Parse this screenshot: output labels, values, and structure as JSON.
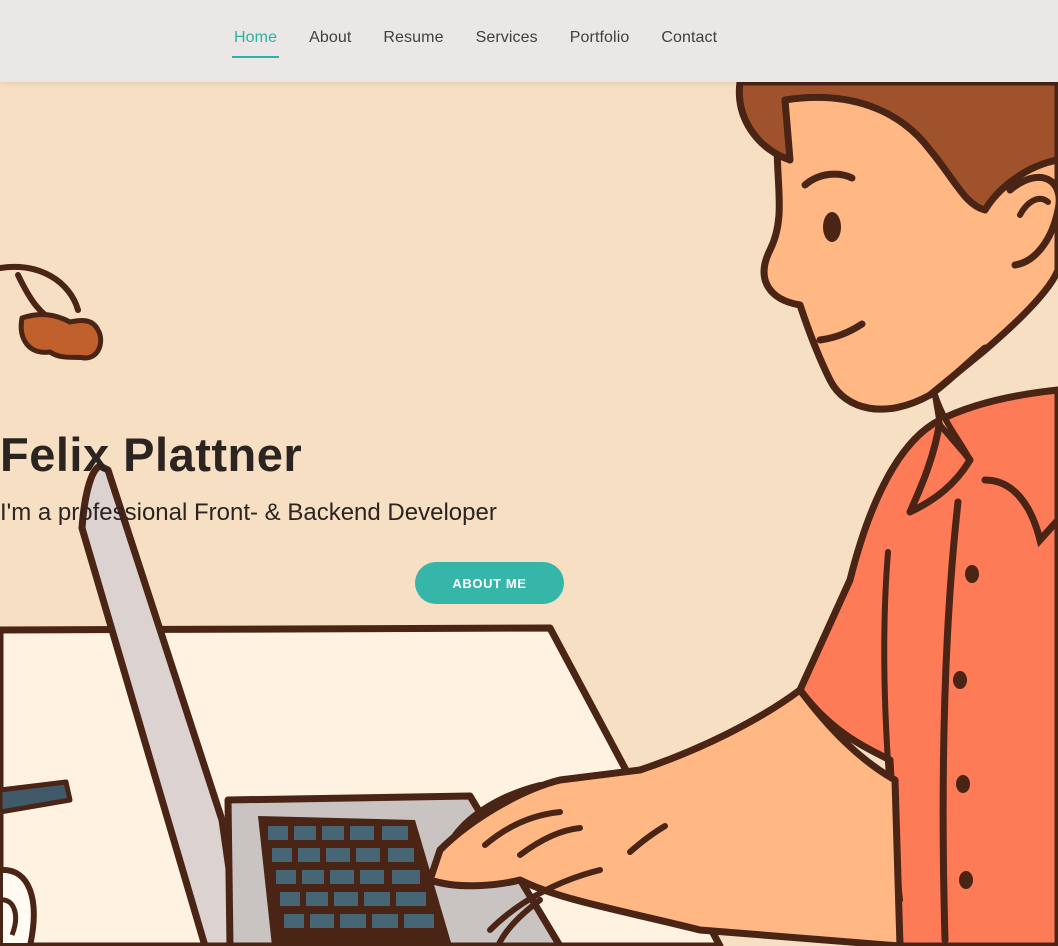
{
  "nav": {
    "items": [
      {
        "label": "Home",
        "active": true
      },
      {
        "label": "About",
        "active": false
      },
      {
        "label": "Resume",
        "active": false
      },
      {
        "label": "Services",
        "active": false
      },
      {
        "label": "Portfolio",
        "active": false
      },
      {
        "label": "Contact",
        "active": false
      }
    ]
  },
  "hero": {
    "title": "Felix Plattner",
    "subtitle": "I'm a professional Front- & Backend Developer",
    "button_label": "ABOUT ME",
    "illustration": "developer-typing-on-laptop"
  },
  "colors": {
    "accent": "#2fb1a2",
    "button": "#36b6a8",
    "header_bg": "#e9e8e6",
    "hero_bg": "#f6dfc2",
    "shirt": "#fe7b57",
    "skin": "#ffb784",
    "hair": "#a0522d",
    "outline": "#4a2415"
  }
}
